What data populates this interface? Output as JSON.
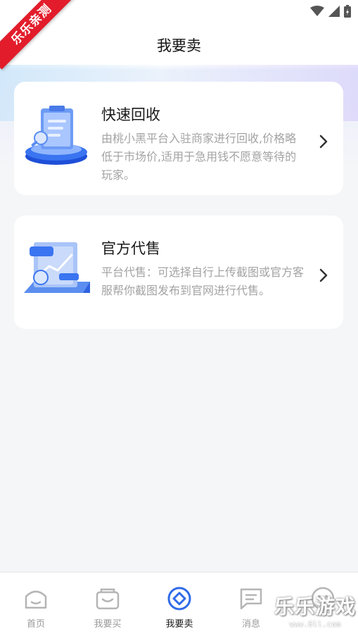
{
  "ribbon": "乐乐亲测",
  "header": {
    "title": "我要卖"
  },
  "cards": [
    {
      "title": "快速回收",
      "desc": "由桃小黑平台入驻商家进行回收,价格略低于市场价,适用于急用钱不愿意等待的玩家。",
      "icon": "clipboard-recycle-icon"
    },
    {
      "title": "官方代售",
      "desc": "平台代售：可选择自行上传截图或官方客服帮你截图发布到官网进行代售。",
      "icon": "chart-consignment-icon"
    }
  ],
  "tabs": [
    {
      "label": "首页",
      "icon": "home-icon",
      "active": false
    },
    {
      "label": "我要买",
      "icon": "shopping-bag-icon",
      "active": false
    },
    {
      "label": "我要卖",
      "icon": "sell-icon",
      "active": true
    },
    {
      "label": "消息",
      "icon": "message-icon",
      "active": false
    },
    {
      "label": "",
      "icon": "profile-icon",
      "active": false
    }
  ],
  "watermark": {
    "text": "乐乐游戏",
    "url": "www.6ll.com"
  },
  "colors": {
    "accent": "#2f6be8",
    "inactive": "#9a9a9a",
    "ribbon": "#e21c2b"
  }
}
